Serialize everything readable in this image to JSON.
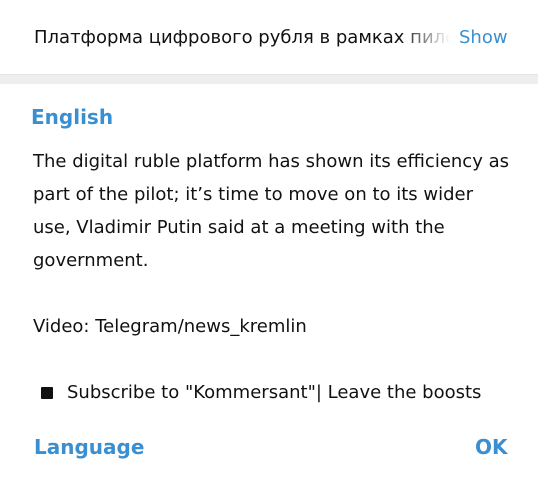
{
  "original": {
    "text": "Платформа цифрового рубля в рамках пилота",
    "show_label": "Show"
  },
  "translation": {
    "language": "English",
    "paragraph1": "The digital ruble platform has shown its efficiency as part of the pilot; it’s time to move on to its wider use, Vladimir Putin said at a meeting with the government.",
    "paragraph2": "Video: Telegram/news_kremlin",
    "paragraph3": "Subscribe to \"Kommersant\"| Leave the boosts",
    "bullet_icon": "black-square-icon"
  },
  "footer": {
    "language_label": "Language",
    "ok_label": "OK"
  },
  "colors": {
    "accent": "#3a8fd1",
    "text": "#111111",
    "separator": "#eeeeee"
  }
}
